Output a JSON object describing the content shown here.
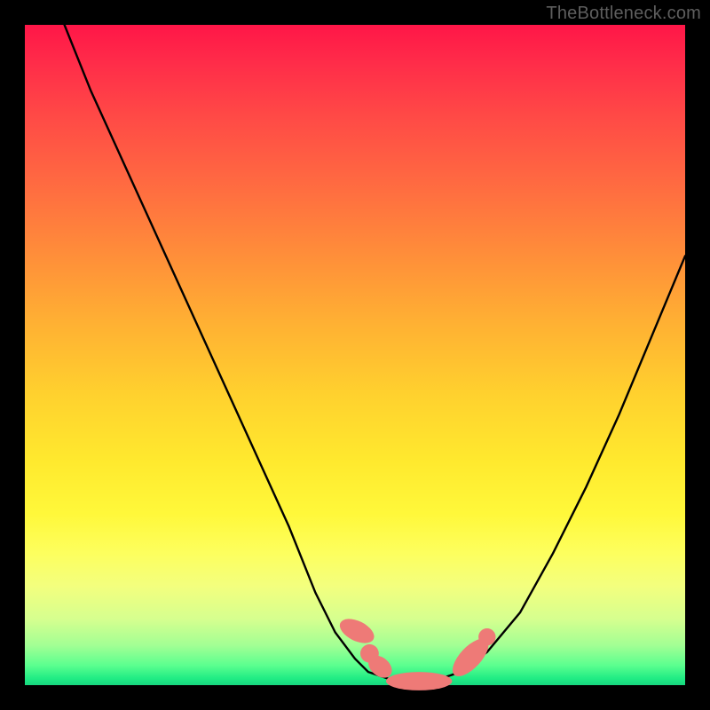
{
  "watermark": "TheBottleneck.com",
  "chart_data": {
    "type": "line",
    "title": "",
    "xlabel": "",
    "ylabel": "",
    "xlim": [
      0,
      100
    ],
    "ylim": [
      0,
      100
    ],
    "series": [
      {
        "name": "bottleneck-curve",
        "x": [
          6,
          10,
          15,
          20,
          25,
          30,
          35,
          40,
          44,
          47,
          50,
          52,
          55,
          58,
          60,
          63,
          66,
          70,
          75,
          80,
          85,
          90,
          95,
          100
        ],
        "y": [
          100,
          90,
          79,
          68,
          57,
          46,
          35,
          24,
          14,
          8,
          4,
          2,
          1,
          0,
          0,
          1,
          2,
          5,
          11,
          20,
          30,
          41,
          53,
          65
        ]
      }
    ],
    "markers": [
      {
        "name": "marker-left-1",
        "shape": "pill",
        "cx": 50.3,
        "cy": 8.2,
        "rx": 1.5,
        "ry": 2.8,
        "angle": -64
      },
      {
        "name": "marker-left-2",
        "shape": "dot",
        "cx": 52.2,
        "cy": 4.8,
        "r": 1.4
      },
      {
        "name": "marker-left-3",
        "shape": "pill",
        "cx": 53.8,
        "cy": 2.8,
        "rx": 1.4,
        "ry": 2.0,
        "angle": -50
      },
      {
        "name": "marker-bottom",
        "shape": "pill",
        "cx": 59.7,
        "cy": 0.6,
        "rx": 5.0,
        "ry": 1.4,
        "angle": 0
      },
      {
        "name": "marker-right-1",
        "shape": "pill",
        "cx": 67.5,
        "cy": 4.2,
        "rx": 1.6,
        "ry": 3.6,
        "angle": 43
      },
      {
        "name": "marker-right-2",
        "shape": "dot",
        "cx": 70.0,
        "cy": 7.3,
        "r": 1.3
      }
    ],
    "colors": {
      "curve": "#000000",
      "marker": "#ee7a77"
    }
  }
}
